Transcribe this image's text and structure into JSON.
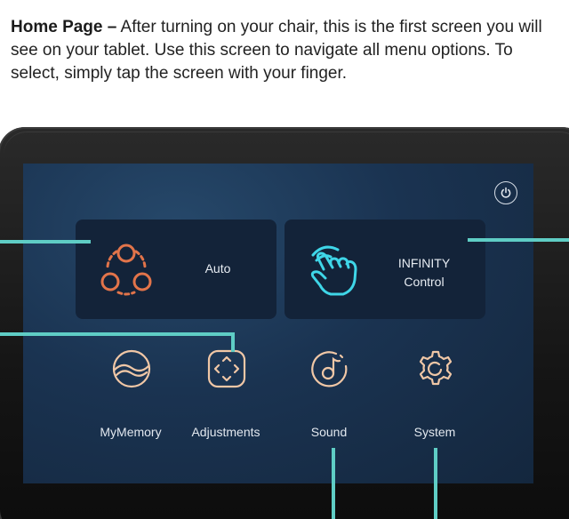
{
  "caption": {
    "lead": "Home Page –",
    "body": " After turning on your chair, this is the first screen you will see on your tablet. Use this screen to navigate all menu options. To select, simply tap the screen with your finger."
  },
  "home_screen": {
    "power_icon": "power-icon",
    "tiles": {
      "auto": {
        "label": "Auto",
        "icon": "auto-program-icon"
      },
      "infinity": {
        "label_line1": "INFINITY",
        "label_line2": "Control",
        "icon": "hand-pointer-icon"
      }
    },
    "menu": {
      "mymemory": {
        "label": "MyMemory",
        "icon": "memory-icon"
      },
      "adjustments": {
        "label": "Adjustments",
        "icon": "adjustments-icon"
      },
      "sound": {
        "label": "Sound",
        "icon": "music-note-icon"
      },
      "system": {
        "label": "System",
        "icon": "gear-icon"
      }
    }
  },
  "colors": {
    "screen_bg": "#1a3351",
    "tile_bg": "#132339",
    "accent_orange": "#e2744a",
    "accent_cyan": "#3fd6e8",
    "menu_icon": "#f0c7a6",
    "callout_line": "#5fcdc5"
  }
}
